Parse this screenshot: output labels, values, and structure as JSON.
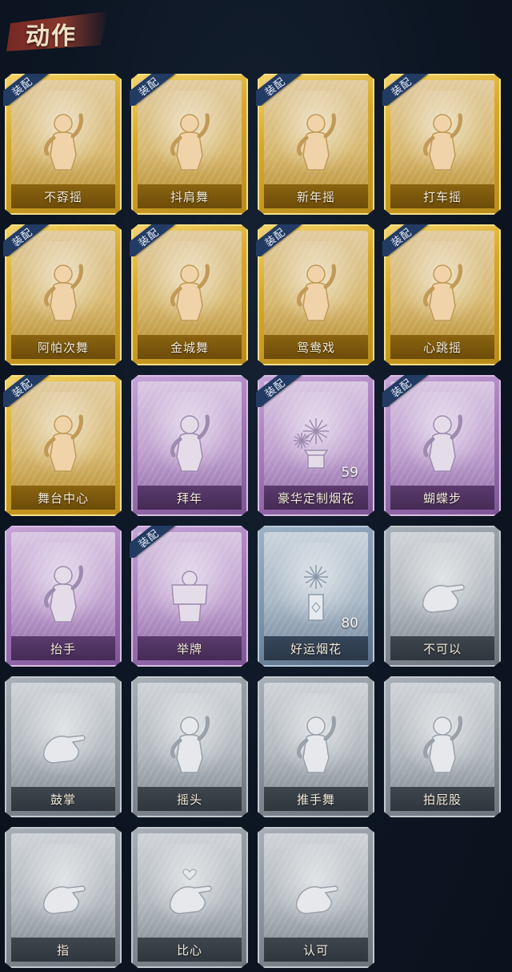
{
  "header": {
    "title": "动作"
  },
  "equipped_badge_label": "装配",
  "items": [
    {
      "label": "不孬摇",
      "rarity": "gold",
      "equipped": true,
      "icon": "dance-pose-icon"
    },
    {
      "label": "抖肩舞",
      "rarity": "gold",
      "equipped": true,
      "icon": "dance-pose-icon"
    },
    {
      "label": "新年摇",
      "rarity": "gold",
      "equipped": true,
      "icon": "dance-pose-icon"
    },
    {
      "label": "打车摇",
      "rarity": "gold",
      "equipped": true,
      "icon": "dance-pose-icon"
    },
    {
      "label": "阿帕次舞",
      "rarity": "gold",
      "equipped": true,
      "icon": "dance-pose-icon"
    },
    {
      "label": "金城舞",
      "rarity": "gold",
      "equipped": true,
      "icon": "dance-pose-icon"
    },
    {
      "label": "鸳鸯戏",
      "rarity": "gold",
      "equipped": true,
      "icon": "dance-pose-icon"
    },
    {
      "label": "心跳摇",
      "rarity": "gold",
      "equipped": true,
      "icon": "dance-pose-icon"
    },
    {
      "label": "舞台中心",
      "rarity": "gold",
      "equipped": true,
      "icon": "dance-pose-icon"
    },
    {
      "label": "拜年",
      "rarity": "purple",
      "equipped": false,
      "icon": "bow-pose-icon"
    },
    {
      "label": "豪华定制烟花",
      "rarity": "purple",
      "equipped": true,
      "icon": "firework-box-icon",
      "count": "59"
    },
    {
      "label": "蝴蝶步",
      "rarity": "purple",
      "equipped": true,
      "icon": "dance-pose-icon"
    },
    {
      "label": "抬手",
      "rarity": "purple",
      "equipped": false,
      "icon": "raise-hand-icon"
    },
    {
      "label": "举牌",
      "rarity": "purple",
      "equipped": true,
      "icon": "sign-board-icon"
    },
    {
      "label": "好运烟花",
      "rarity": "blue",
      "equipped": false,
      "icon": "firework-tube-icon",
      "count": "80"
    },
    {
      "label": "不可以",
      "rarity": "grey",
      "equipped": false,
      "icon": "finger-wag-icon"
    },
    {
      "label": "鼓掌",
      "rarity": "grey",
      "equipped": false,
      "icon": "clap-hands-icon"
    },
    {
      "label": "摇头",
      "rarity": "grey",
      "equipped": false,
      "icon": "shake-head-icon"
    },
    {
      "label": "推手舞",
      "rarity": "grey",
      "equipped": false,
      "icon": "push-hands-icon"
    },
    {
      "label": "拍屁股",
      "rarity": "grey",
      "equipped": false,
      "icon": "slap-pose-icon"
    },
    {
      "label": "指",
      "rarity": "grey",
      "equipped": false,
      "icon": "pointing-hand-icon"
    },
    {
      "label": "比心",
      "rarity": "grey",
      "equipped": false,
      "icon": "finger-heart-icon"
    },
    {
      "label": "认可",
      "rarity": "grey",
      "equipped": false,
      "icon": "thumbs-up-icon"
    }
  ]
}
